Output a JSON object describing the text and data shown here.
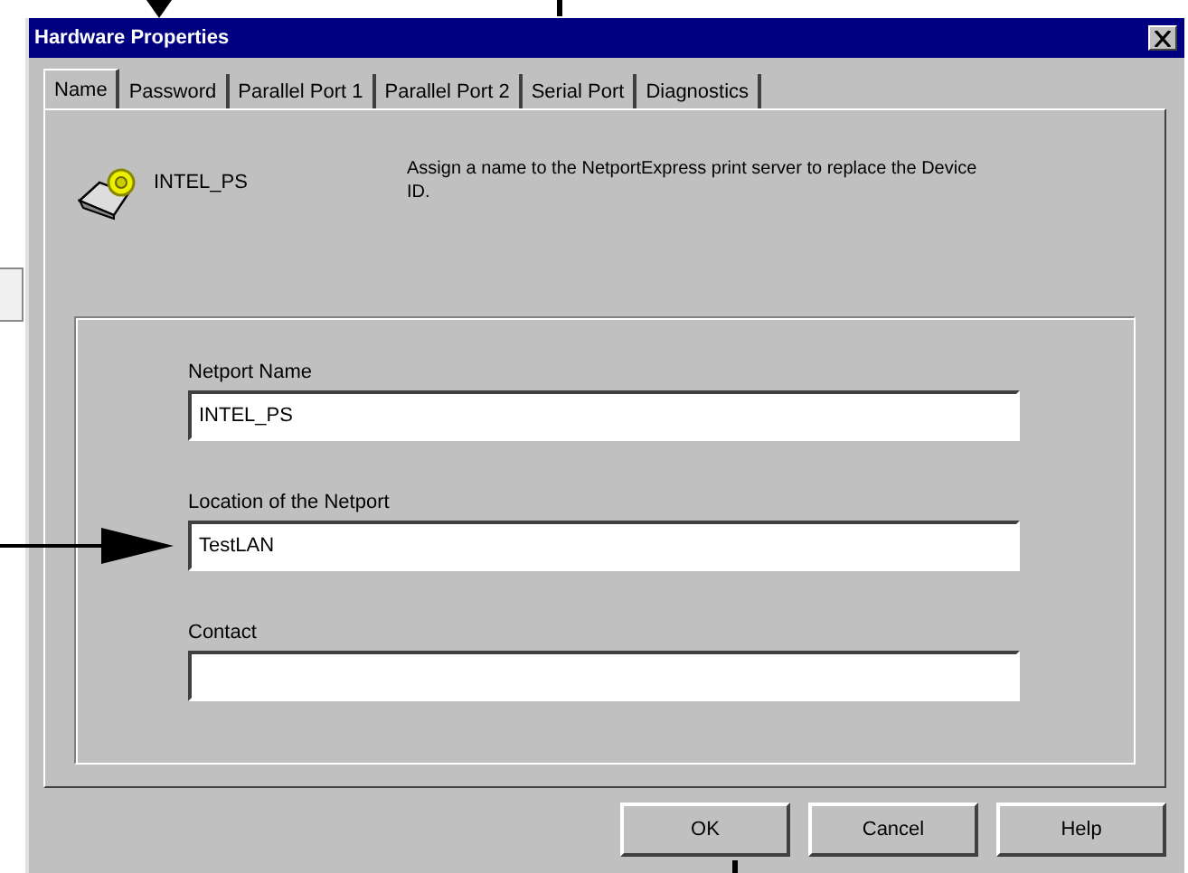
{
  "window": {
    "title": "Hardware Properties"
  },
  "tabs": [
    {
      "label": "Name",
      "selected": true
    },
    {
      "label": "Password",
      "selected": false
    },
    {
      "label": "Parallel Port 1",
      "selected": false
    },
    {
      "label": "Parallel Port 2",
      "selected": false
    },
    {
      "label": "Serial Port",
      "selected": false
    },
    {
      "label": "Diagnostics",
      "selected": false
    }
  ],
  "device": {
    "name": "INTEL_PS",
    "description": "Assign a name to the NetportExpress print server to replace the Device ID."
  },
  "fields": [
    {
      "label": "Netport Name",
      "value": "INTEL_PS"
    },
    {
      "label": "Location of the Netport",
      "value": "TestLAN"
    },
    {
      "label": "Contact"
    }
  ],
  "buttons": [
    "OK",
    "Cancel",
    "Help"
  ]
}
